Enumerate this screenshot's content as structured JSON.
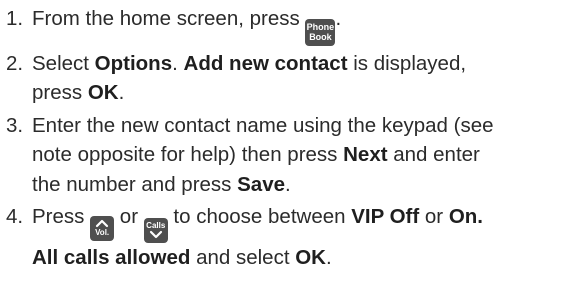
{
  "steps": [
    {
      "num": "1.",
      "lines": [
        {
          "pre": "From the home screen, press ",
          "key_line1": "Phone",
          "key_line2": "Book",
          "post": "."
        }
      ]
    },
    {
      "num": "2.",
      "l1_a": "Select ",
      "l1_b": "Options",
      "l1_c": ". ",
      "l1_d": "Add new contact",
      "l1_e": " is displayed,",
      "l2_a": "press ",
      "l2_b": "OK",
      "l2_c": "."
    },
    {
      "num": "3.",
      "l1": "Enter the new contact name using the keypad (see",
      "l2_a": "note opposite for help) then press ",
      "l2_b": "Next",
      "l2_c": " and enter",
      "l3_a": "the number and press ",
      "l3_b": "Save",
      "l3_c": "."
    },
    {
      "num": "4.",
      "l1_a": "Press ",
      "key_vol": "Vol.",
      "l1_b": " or ",
      "key_calls": "Calls",
      "l1_c": " to choose between ",
      "l1_d": "VIP Off",
      "l1_e": " or ",
      "l1_f": "On.",
      "l2_a": "All calls allowed",
      "l2_b": " and select ",
      "l2_c": "OK",
      "l2_d": "."
    }
  ]
}
